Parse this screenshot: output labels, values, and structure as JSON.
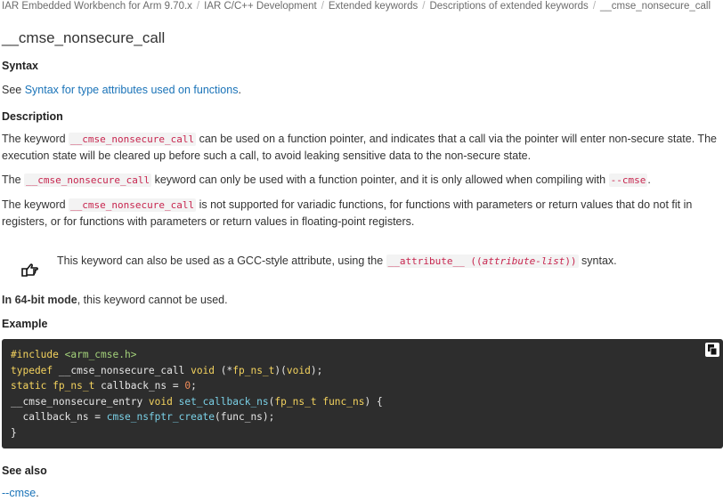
{
  "breadcrumb": {
    "items": [
      "IAR Embedded Workbench for Arm 9.70.x",
      "IAR C/C++ Development",
      "Extended keywords",
      "Descriptions of extended keywords",
      "__cmse_nonsecure_call"
    ],
    "separator": "/"
  },
  "title": "__cmse_nonsecure_call",
  "syntax": {
    "heading": "Syntax",
    "prefix": "See ",
    "link": "Syntax for type attributes used on functions",
    "suffix": "."
  },
  "description": {
    "heading": "Description",
    "p1_a": "The keyword ",
    "p1_code": "__cmse_nonsecure_call",
    "p1_b": " can be used on a function pointer, and indicates that a call via the pointer will enter non-secure state. The execution state will be cleared up before such a call, to avoid leaking sensitive data to the non-secure state.",
    "p2_a": "The ",
    "p2_code": "__cmse_nonsecure_call",
    "p2_b": " keyword can only be used with a function pointer, and it is only allowed when compiling with ",
    "p2_code2": "--cmse",
    "p2_c": ".",
    "p3_a": "The keyword ",
    "p3_code": "__cmse_nonsecure_call",
    "p3_b": " is not supported for variadic functions, for functions with parameters or return values that do not fit in registers, or for functions with parameters or return values in floating-point registers."
  },
  "note": {
    "icon": "pointing-hand-icon",
    "text_a": "This keyword can also be used as a GCC-style attribute, using the ",
    "code_a": "__attribute__ ((",
    "code_b": "attribute-list",
    "code_c": "))",
    "text_b": " syntax."
  },
  "mode": {
    "bold": "In 64-bit mode",
    "rest": ", this keyword cannot be used."
  },
  "example": {
    "heading": "Example",
    "lines": [
      [
        "#include ",
        "<arm_cmse.h>"
      ],
      [
        "typedef",
        " __cmse_nonsecure_call ",
        "void",
        " (*",
        "fp_ns_t",
        ")(",
        "void",
        ");"
      ],
      [
        "static",
        " ",
        "fp_ns_t",
        " callback_ns = ",
        "0",
        ";"
      ],
      [
        "__cmse_nonsecure_entry ",
        "void",
        " ",
        "set_callback_ns",
        "(",
        "fp_ns_t",
        " ",
        "func_ns",
        ") {"
      ],
      [
        "  callback_ns = ",
        "cmse_nsfptr_create",
        "(func_ns);"
      ],
      [
        "}"
      ]
    ],
    "copy_icon": "copy-icon"
  },
  "see_also": {
    "heading": "See also",
    "link": "--cmse",
    "suffix": "."
  }
}
